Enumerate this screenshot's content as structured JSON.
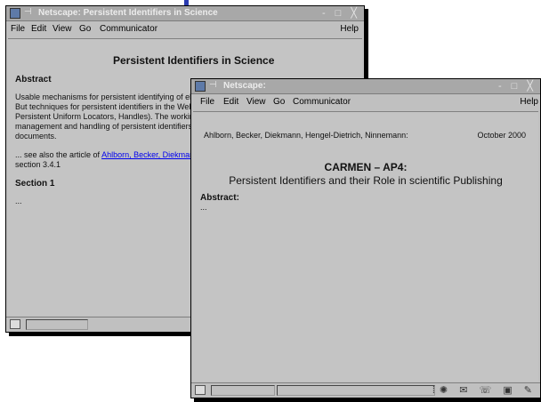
{
  "colors": {
    "accent": "#2a3bb0",
    "window_bg": "#c0c0c0",
    "link": "#0000ee"
  },
  "window1": {
    "title": "Netscape: Persistent Identifiers in Science",
    "controls": "- □ ╳",
    "menu": {
      "file": "File",
      "edit": "Edit",
      "view": "View",
      "go": "Go",
      "communicator": "Communicator",
      "help": "Help"
    },
    "heading": "Persistent Identifiers in Science",
    "abstract_label": "Abstract",
    "lines": [
      "Usable mechanisms for persistent identifying of ele",
      "But techniques for persistent identifiers in the Web",
      "Persistent Uniform Locators, Handles). The workin",
      "management and handling of persistent identifiers",
      "documents."
    ],
    "see_also_prefix": "... see also the article of ",
    "see_also_link": "Ahlborn, Becker, Diekmar",
    "section_ref": "section 3.4.1",
    "section1_label": "Section 1",
    "section1_body": "..."
  },
  "window2": {
    "title": "Netscape:",
    "controls": "- □ ╳",
    "menu": {
      "file": "File",
      "edit": "Edit",
      "view": "View",
      "go": "Go",
      "communicator": "Communicator",
      "help": "Help"
    },
    "authors": "Ahlborn, Becker, Diekmann, Hengel-Dietrich, Ninnemann:",
    "date": "October 2000",
    "heading1": "CARMEN – AP4:",
    "heading2": "Persistent Identifiers and their Role in scientific Publishing",
    "abstract_label": "Abstract:",
    "abstract_body": "..."
  }
}
